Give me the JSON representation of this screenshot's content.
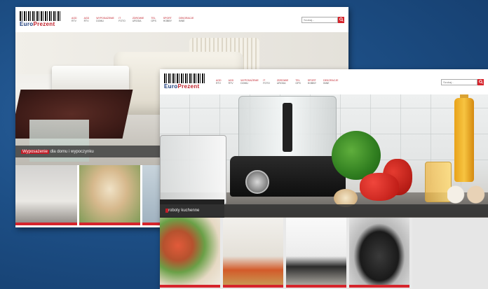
{
  "brand": {
    "logo_text_a": "Euro",
    "logo_text_b": "Prezent"
  },
  "nav": [
    {
      "main": "AGD",
      "sub": "RTV"
    },
    {
      "main": "AGD",
      "sub": "RTV"
    },
    {
      "main": "WYPOSAŻENIE",
      "sub": "DOMU"
    },
    {
      "main": "IT",
      "sub": "FOTO"
    },
    {
      "main": "ZDROWIE",
      "sub": "URODA"
    },
    {
      "main": "TEL",
      "sub": "GPS"
    },
    {
      "main": "SPORT",
      "sub": "HOBBY"
    },
    {
      "main": "DEKORACJE",
      "sub": "INNE"
    }
  ],
  "search": {
    "placeholder": "Szukaj..."
  },
  "screen1": {
    "band": {
      "highlight": "Wyposażenie",
      "rest": "dla domu i wypoczynku"
    }
  },
  "screen2": {
    "band": {
      "highlight": "",
      "rest": "roboty kuchenne"
    }
  },
  "colors": {
    "background": "#1d4f86",
    "accent_red": "#d6242c",
    "brand_blue": "#1b3b7a"
  }
}
